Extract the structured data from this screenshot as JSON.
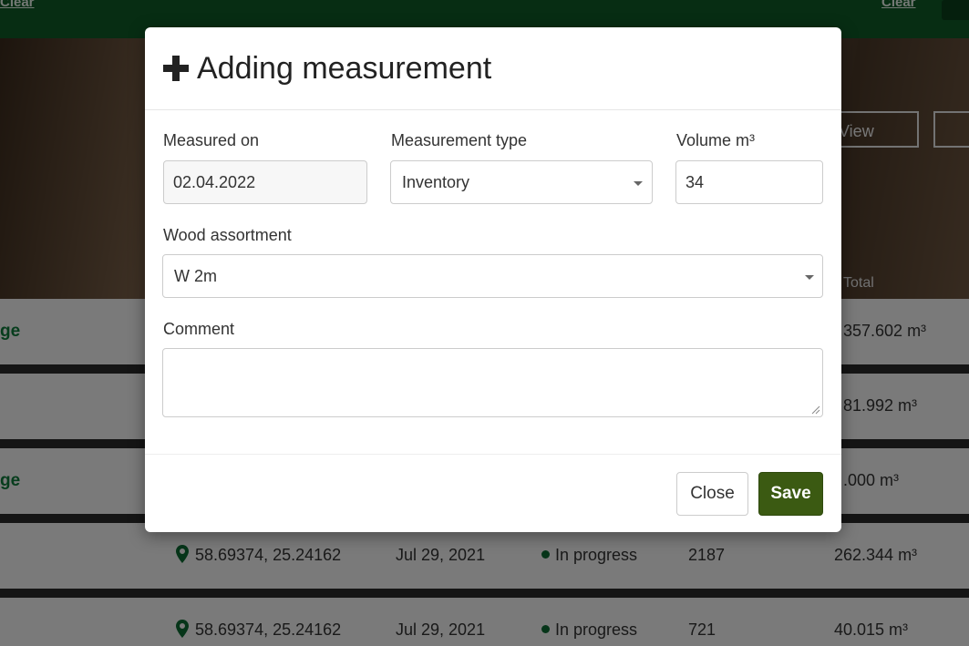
{
  "background": {
    "topbar": {
      "left_link": "Clear",
      "right_link": "Clear"
    },
    "hero": {
      "button_one": "View",
      "total_header": "Total"
    },
    "rows": [
      {
        "name": "ge",
        "total": "357.602 m³"
      },
      {
        "name": "",
        "total": "81.992 m³"
      },
      {
        "name": "ge",
        "total": ".000 m³"
      },
      {
        "coords": "58.69374, 25.24162",
        "date": "Jul 29, 2021",
        "status": "In progress",
        "count": "2187",
        "total": "262.344 m³"
      },
      {
        "coords": "58.69374, 25.24162",
        "date": "Jul 29, 2021",
        "status": "In progress",
        "count": "721",
        "total": "40.015 m³"
      }
    ]
  },
  "modal": {
    "title": "Adding measurement",
    "fields": {
      "measured_on": {
        "label": "Measured on",
        "value": "02.04.2022"
      },
      "measurement_type": {
        "label": "Measurement type",
        "value": "Inventory"
      },
      "volume": {
        "label": "Volume m³",
        "value": "34"
      },
      "wood_assortment": {
        "label": "Wood assortment",
        "value": "W 2m"
      },
      "comment": {
        "label": "Comment",
        "value": ""
      }
    },
    "buttons": {
      "close": "Close",
      "save": "Save"
    }
  },
  "colors": {
    "brand_green": "#0f5a26",
    "save_button": "#3b5a12",
    "status_dot": "#0d6b33"
  }
}
